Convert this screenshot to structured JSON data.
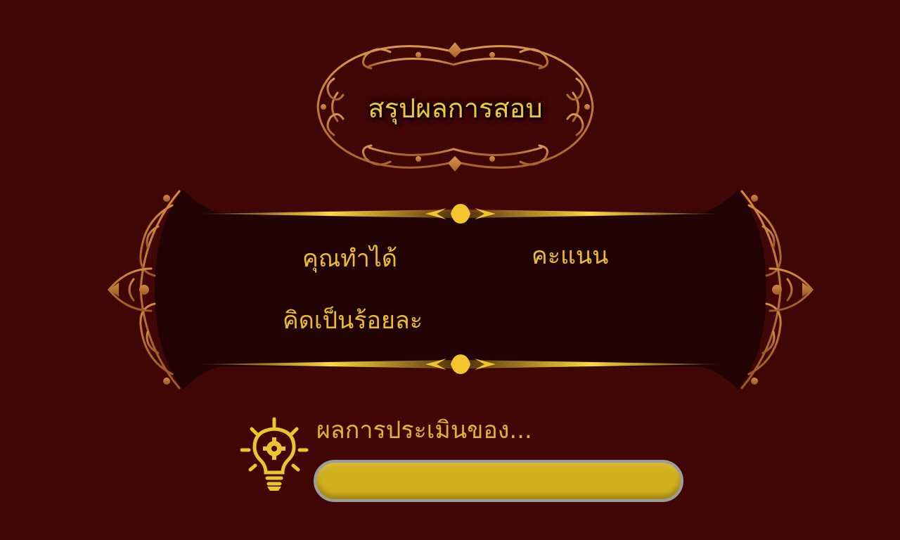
{
  "title": "สรุปผลการสอบ",
  "summary": {
    "you_got_label": "คุณทำได้",
    "points_label": "คะแนน",
    "percent_label": "คิดเป็นร้อยละ"
  },
  "evaluation": {
    "label": "ผลการประเมินของ...",
    "icon": "lightbulb-gear-icon"
  },
  "colors": {
    "background": "#420607",
    "panel": "#210303",
    "gold": "#f1c736",
    "ornament": "#b9772e",
    "bar_fill": "#d2b11e",
    "bar_border": "#9c9c9c"
  }
}
